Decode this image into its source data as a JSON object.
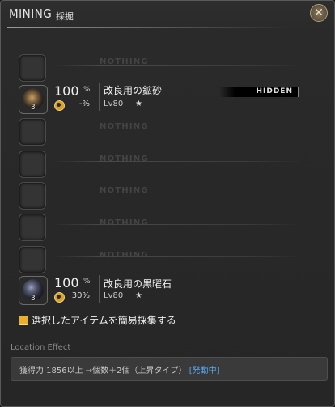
{
  "window": {
    "title": "MINING",
    "subtitle": "採掘",
    "close_icon": "close-x-icon"
  },
  "placeholder_text": "NOTHING",
  "items": [
    {
      "name": "改良用の鉱砂",
      "level": "Lv80",
      "star": "★",
      "quantity": "3",
      "success_rate": "100",
      "percent_sign": "%",
      "hq_rate": "-%",
      "badge": "HIDDEN",
      "icon": "sand-ore-icon"
    },
    {
      "name": "改良用の黒曜石",
      "level": "Lv80",
      "star": "★",
      "quantity": "3",
      "success_rate": "100",
      "percent_sign": "%",
      "hq_rate": "30%",
      "icon": "obsidian-icon"
    }
  ],
  "quick_gather": {
    "label": "選択したアイテムを簡易採集する",
    "checked": true
  },
  "location_effect": {
    "header": "Location Effect",
    "text": "獲得力 1856以上 →個数＋2個（上昇タイプ）",
    "status": "[発動中]",
    "status_color": "#5aa8f0"
  },
  "colors": {
    "accent_gold": "#e8b030",
    "background": "#2a2a2a"
  }
}
